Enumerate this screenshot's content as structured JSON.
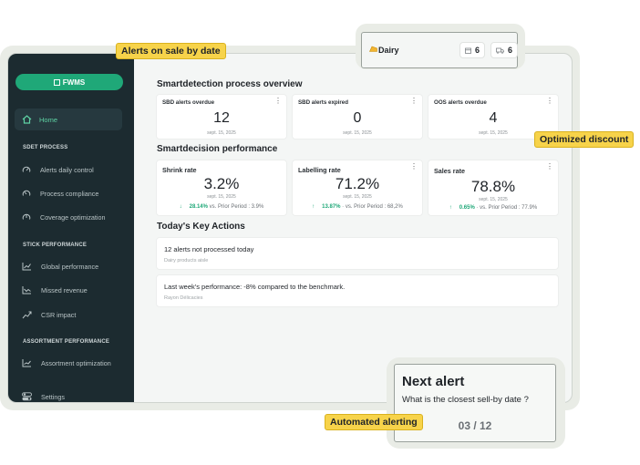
{
  "callouts": {
    "alerts_on_sale": "Alerts on sale by date",
    "optimized_discount": "Optimized discount",
    "automated_alerting": "Automated alerting"
  },
  "dairy_widget": {
    "label": "Dairy",
    "count_a": "6",
    "count_b": "6"
  },
  "next_alert": {
    "title": "Next alert",
    "question": "What is the closest sell-by date ?",
    "counter": "03 / 12"
  },
  "sidebar": {
    "brand": "FWMS",
    "home": "Home",
    "sections": [
      {
        "label": "SDET PROCESS",
        "items": [
          "Alerts daily control",
          "Process compliance",
          "Coverage optimization"
        ]
      },
      {
        "label": "STICK PERFORMANCE",
        "items": [
          "Global performance",
          "Missed revenue",
          "CSR impact"
        ]
      },
      {
        "label": "ASSORTMENT PERFORMANCE",
        "items": [
          "Assortment optimization"
        ]
      }
    ],
    "settings": "Settings"
  },
  "main": {
    "overview_title": "Smartdetection process overview",
    "overview_cards": [
      {
        "label": "SBD alerts overdue",
        "value": "12",
        "date": "sept. 15, 2025"
      },
      {
        "label": "SBD alerts expired",
        "value": "0",
        "date": "sept. 15, 2025"
      },
      {
        "label": "OOS alerts overdue",
        "value": "4",
        "date": "sept. 15, 2025"
      }
    ],
    "performance_title": "Smartdecision performance",
    "performance_cards": [
      {
        "label": "Shrink rate",
        "value": "3.2%",
        "date": "sept. 15, 2025",
        "delta_pct": "28.14%",
        "delta_text": "vs. Prior Period : 3.9%"
      },
      {
        "label": "Labelling rate",
        "value": "71.2%",
        "date": "sept. 15, 2025",
        "delta_pct": "13.87%",
        "delta_text": "· vs. Prior Period : 68,2%"
      },
      {
        "label": "Sales rate",
        "value": "78.8%",
        "date": "sept. 15, 2025",
        "delta_pct": "0.65%",
        "delta_text": "· vs. Prior Period : 77.9%"
      }
    ],
    "actions_title": "Today's Key Actions",
    "actions": [
      {
        "title": "12 alerts not processed today",
        "subtitle": "Dairy products aisle"
      },
      {
        "title": "Last week's performance: -8% compared to the benchmark.",
        "subtitle": "Rayon Délicacies"
      }
    ]
  },
  "colors": {
    "sidebar_bg": "#1c2b30",
    "accent_green": "#1fa878",
    "callout_yellow": "#f7d34a"
  }
}
